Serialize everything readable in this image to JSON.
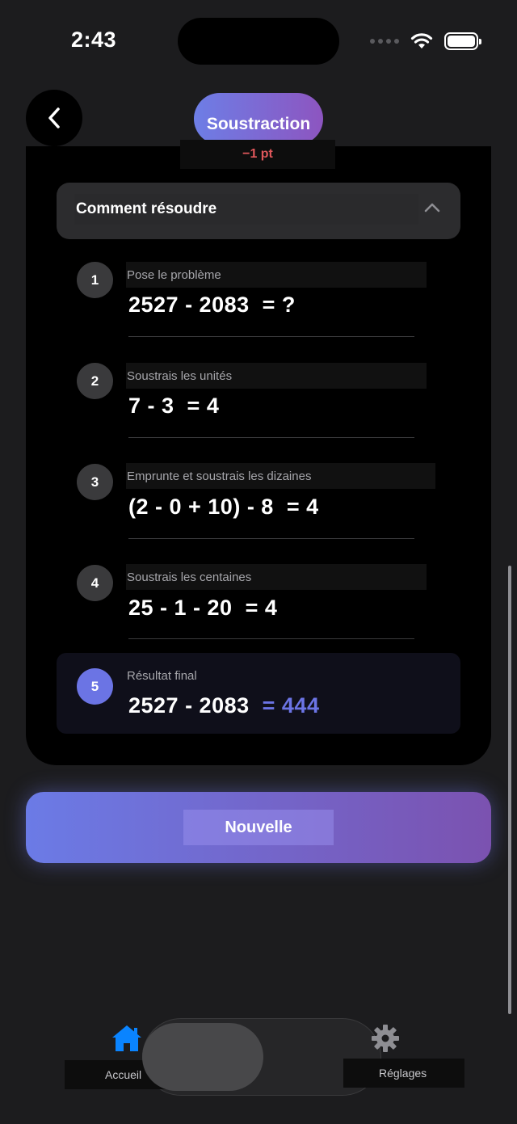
{
  "status_bar": {
    "time": "2:43"
  },
  "header": {
    "title": "Soustraction",
    "points": "−1 pt"
  },
  "howto": {
    "label": "Comment résoudre"
  },
  "steps": [
    {
      "num": "1",
      "label": "Pose le problème",
      "expr": "2527 - 2083",
      "result": "= ?"
    },
    {
      "num": "2",
      "label": "Soustrais les unités",
      "expr": "7 - 3",
      "result": "= 4"
    },
    {
      "num": "3",
      "label": "Emprunte et soustrais les dizaines",
      "expr": "(2 - 0 + 10) - 8",
      "result": "= 4"
    },
    {
      "num": "4",
      "label": "Soustrais les centaines",
      "expr": "25 - 1 - 20",
      "result": "= 4"
    }
  ],
  "final": {
    "num": "5",
    "label": "Résultat final",
    "expr": "2527 - 2083",
    "result": "= 444"
  },
  "new_button": {
    "label": "Nouvelle"
  },
  "tabbar": {
    "home_label": "Accueil",
    "settings_label": "Réglages"
  },
  "colors": {
    "accent": "#6b74e4",
    "points": "#e0575b",
    "home_tab": "#0a84ff"
  }
}
